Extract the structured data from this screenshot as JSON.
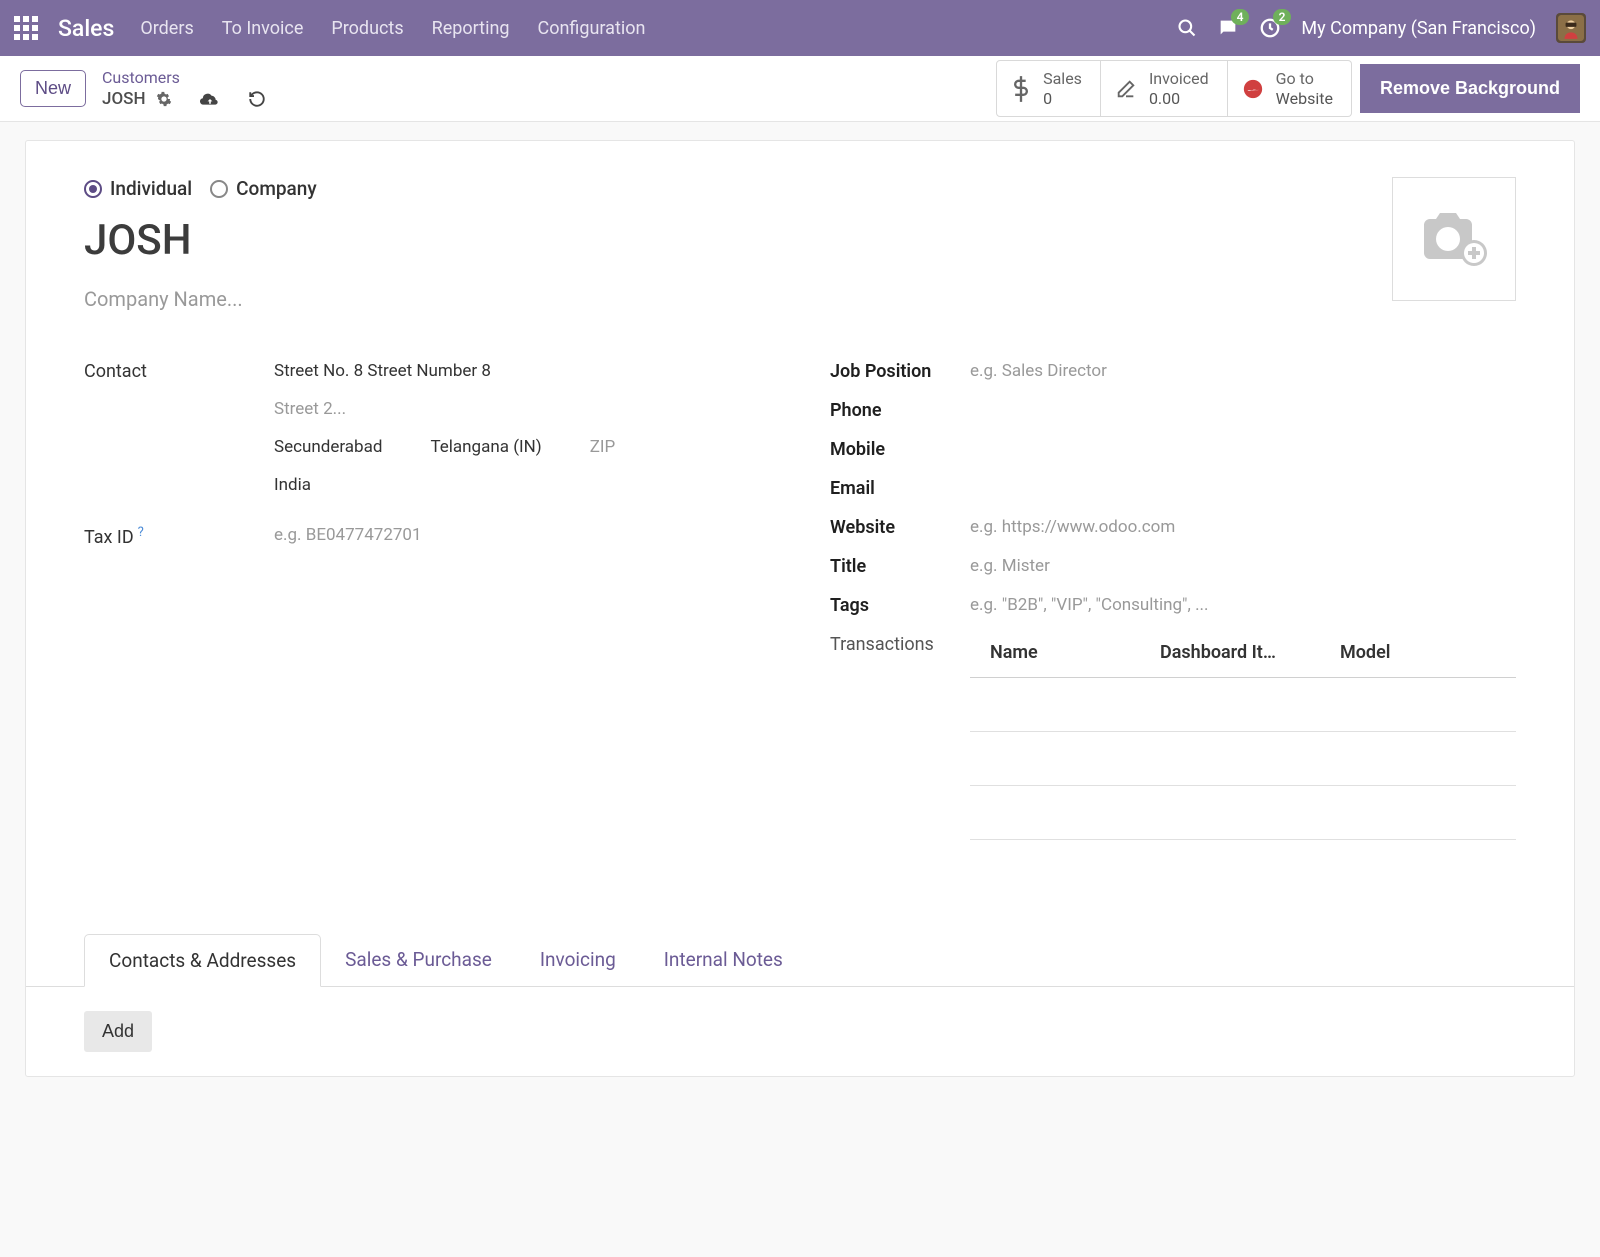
{
  "nav": {
    "brand": "Sales",
    "items": [
      "Orders",
      "To Invoice",
      "Products",
      "Reporting",
      "Configuration"
    ],
    "chat_badge": "4",
    "activity_badge": "2",
    "company": "My Company (San Francisco)"
  },
  "actionbar": {
    "new_label": "New",
    "breadcrumb_parent": "Customers",
    "breadcrumb_current": "JOSH",
    "stats": {
      "sales_label": "Sales",
      "sales_value": "0",
      "invoiced_label": "Invoiced",
      "invoiced_value": "0.00",
      "website_line1": "Go to",
      "website_line2": "Website"
    },
    "remove_bg": "Remove Background"
  },
  "form": {
    "radio_individual": "Individual",
    "radio_company": "Company",
    "name": "JOSH",
    "company_placeholder": "Company Name...",
    "contact_label": "Contact",
    "street1": "Street No. 8 Street Number 8",
    "street2_placeholder": "Street 2...",
    "city": "Secunderabad",
    "state": "Telangana (IN)",
    "zip_placeholder": "ZIP",
    "country": "India",
    "taxid_label": "Tax ID",
    "taxid_placeholder": "e.g. BE0477472701",
    "job_label": "Job Position",
    "job_placeholder": "e.g. Sales Director",
    "phone_label": "Phone",
    "mobile_label": "Mobile",
    "email_label": "Email",
    "website_label": "Website",
    "website_placeholder": "e.g. https://www.odoo.com",
    "title_label": "Title",
    "title_placeholder": "e.g. Mister",
    "tags_label": "Tags",
    "tags_placeholder": "e.g. \"B2B\", \"VIP\", \"Consulting\", ...",
    "transactions_label": "Transactions",
    "th_name": "Name",
    "th_dash": "Dashboard It…",
    "th_model": "Model"
  },
  "tabs": {
    "contacts": "Contacts & Addresses",
    "sales": "Sales & Purchase",
    "invoicing": "Invoicing",
    "notes": "Internal Notes",
    "add_label": "Add"
  }
}
